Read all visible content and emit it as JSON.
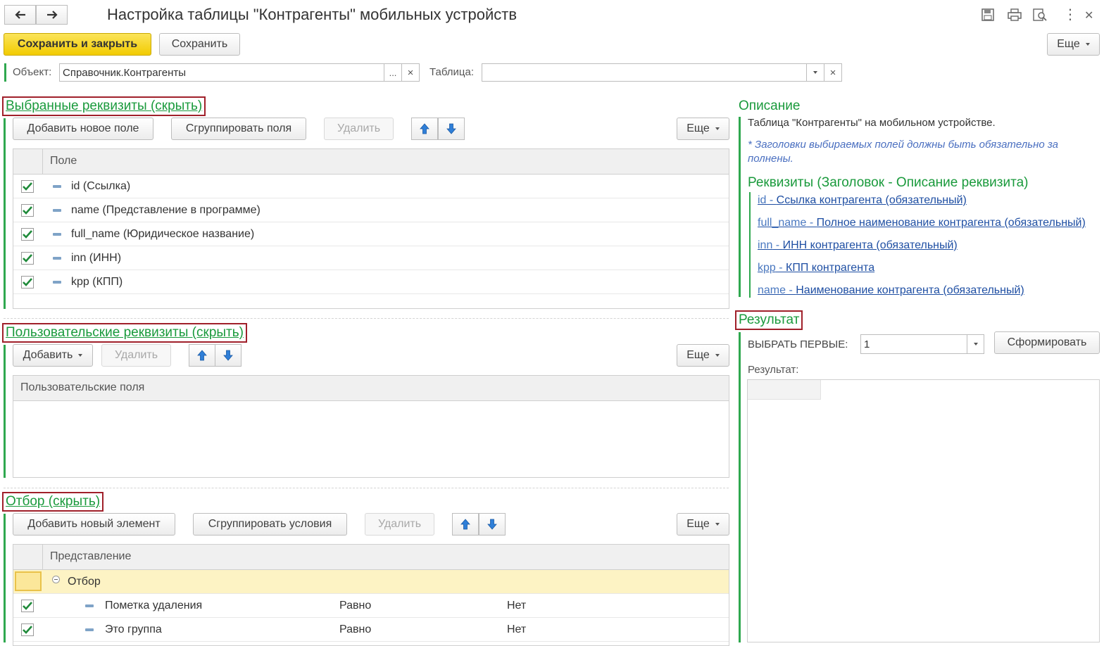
{
  "window": {
    "title": "Настройка таблицы \"Контрагенты\" мобильных устройств",
    "more_menu": "⋮"
  },
  "toolbar": {
    "save_close": "Сохранить и закрыть",
    "save": "Сохранить",
    "more": "Еще"
  },
  "object_row": {
    "object_label": "Объект:",
    "object_value": "Справочник.Контрагенты",
    "ellipsis": "...",
    "clear": "×",
    "table_label": "Таблица:",
    "table_value": ""
  },
  "selected_section": {
    "title": "Выбранные реквизиты (скрыть)",
    "add_button": "Добавить новое поле",
    "group_button": "Сгруппировать поля",
    "delete_button": "Удалить",
    "more_button": "Еще",
    "column_header": "Поле",
    "rows": [
      {
        "label": "id (Ссылка)",
        "checked": true
      },
      {
        "label": "name (Представление в программе)",
        "checked": true
      },
      {
        "label": "full_name (Юридическое название)",
        "checked": true
      },
      {
        "label": "inn (ИНН)",
        "checked": true
      },
      {
        "label": "kpp (КПП)",
        "checked": true
      }
    ]
  },
  "custom_section": {
    "title": "Пользовательские реквизиты (скрыть)",
    "add_button": "Добавить",
    "delete_button": "Удалить",
    "more_button": "Еще",
    "column_header": "Пользовательские поля"
  },
  "filter_section": {
    "title": "Отбор (скрыть)",
    "add_button": "Добавить новый элемент",
    "group_button": "Сгруппировать условия",
    "delete_button": "Удалить",
    "more_button": "Еще",
    "column_header": "Представление",
    "group_row": "Отбор",
    "rows": [
      {
        "label": "Пометка удаления",
        "condition": "Равно",
        "value": "Нет",
        "checked": true
      },
      {
        "label": "Это группа",
        "condition": "Равно",
        "value": "Нет",
        "checked": true
      }
    ]
  },
  "description": {
    "title": "Описание",
    "text": "Таблица \"Контрагенты\" на мобильном устройстве.",
    "note_line1": "* Заголовки выбираемых полей должны быть обязательно за",
    "note_line2": "полнены.",
    "attrs_title": "Реквизиты (Заголовок - Описание реквизита)",
    "attrs": [
      {
        "name": "id",
        "desc": "Ссылка контрагента (обязательный)"
      },
      {
        "name": "full_name",
        "desc": "Полное наименование контрагента (обязательный)"
      },
      {
        "name": "inn",
        "desc": "ИНН контрагента (обязательный)"
      },
      {
        "name": "kpp",
        "desc": "КПП контрагента"
      },
      {
        "name": "name",
        "desc": "Наименование контрагента (обязательный)"
      }
    ],
    "sep": " - "
  },
  "result": {
    "title": "Результат",
    "select_first_label": "ВЫБРАТЬ ПЕРВЫЕ:",
    "select_first_value": "1",
    "generate_button": "Сформировать",
    "result_label": "Результат:"
  },
  "colors": {
    "accent_green": "#1a9a3c",
    "highlight_border": "#a0202a",
    "link_blue": "#1f4fa3",
    "primary_button": "#f2cb00",
    "selected_row": "#fdf3c4"
  }
}
